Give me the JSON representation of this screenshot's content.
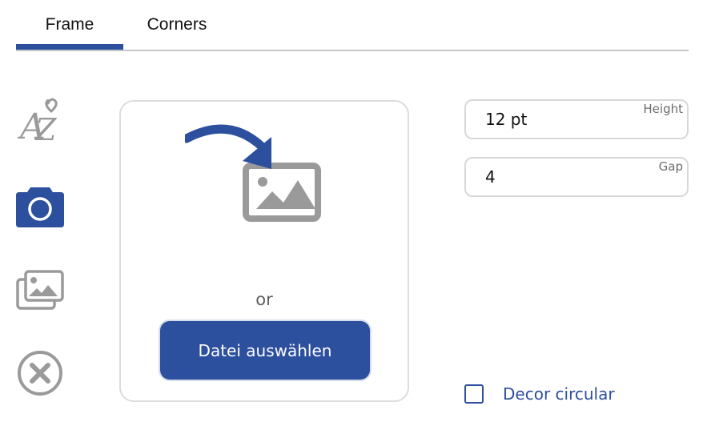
{
  "tabs": [
    {
      "label": "Frame",
      "active": true
    },
    {
      "label": "Corners",
      "active": false
    }
  ],
  "sidebar": {
    "items": [
      {
        "icon": "az-text-icon",
        "active": false
      },
      {
        "icon": "camera-icon",
        "active": true
      },
      {
        "icon": "gallery-icon",
        "active": false
      },
      {
        "icon": "remove-circle-icon",
        "active": false
      }
    ]
  },
  "upload": {
    "or_text": "or",
    "button_label": "Datei auswählen"
  },
  "fields": {
    "height": {
      "label": "Height",
      "value": "12 pt"
    },
    "gap": {
      "label": "Gap",
      "value": "4"
    }
  },
  "checkbox": {
    "label": "Decor circular",
    "checked": false
  },
  "colors": {
    "accent": "#2c4f9e",
    "icon_gray": "#9a9a9a",
    "border": "#d8d8d8"
  }
}
